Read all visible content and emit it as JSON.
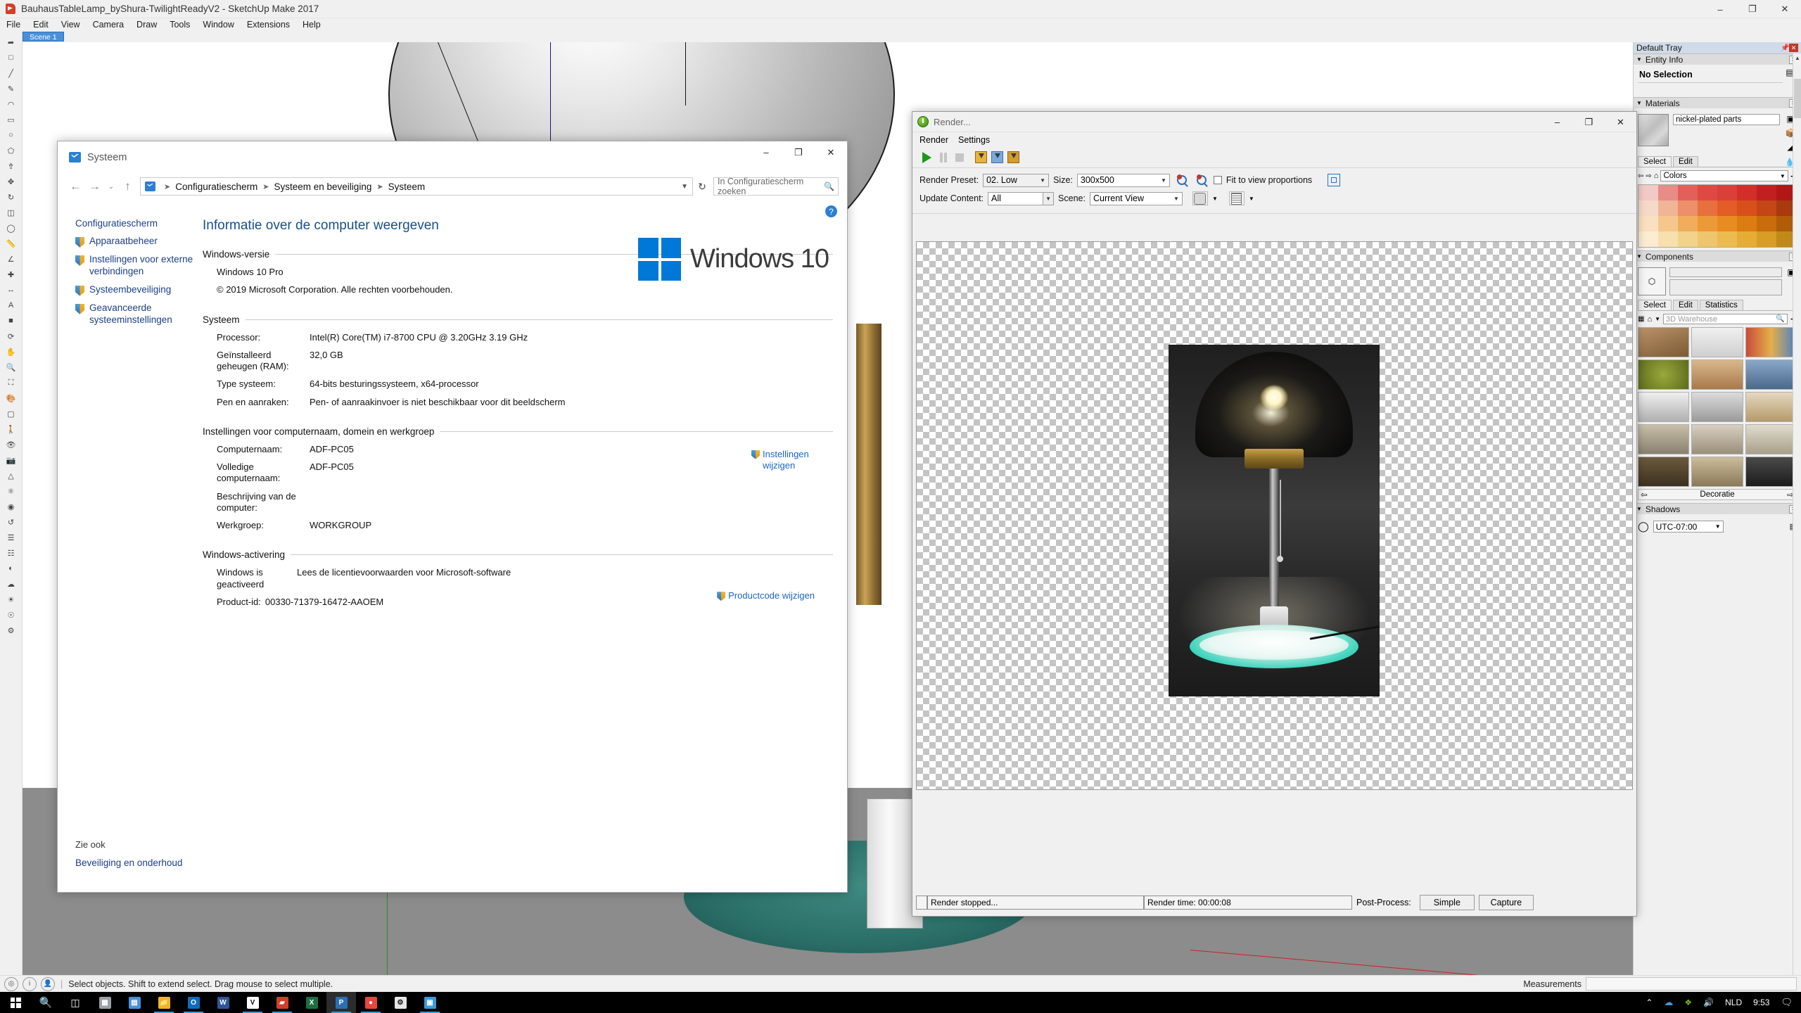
{
  "sketchup": {
    "title": "BauhausTableLamp_byShura-TwilightReadyV2 - SketchUp Make 2017",
    "menus": [
      "File",
      "Edit",
      "View",
      "Camera",
      "Draw",
      "Tools",
      "Window",
      "Extensions",
      "Help"
    ],
    "scene_tab": "Scene 1",
    "window_buttons": {
      "minimize": "–",
      "maximize": "❐",
      "close": "✕"
    },
    "status_text": "Select objects. Shift to extend select. Drag mouse to select multiple.",
    "measurements_label": "Measurements",
    "measurements_value": ""
  },
  "tray": {
    "title": "Default Tray",
    "pin": "📌",
    "close": "✕",
    "panels": {
      "entity_info": {
        "title": "Entity Info",
        "selection": "No Selection"
      },
      "materials": {
        "title": "Materials",
        "material_name": "nickel-plated parts",
        "tabs": [
          "Select",
          "Edit"
        ],
        "active_tab": "Select",
        "collection": "Colors",
        "swatches": [
          "#f2c9c6",
          "#e78c86",
          "#e3605a",
          "#de4a43",
          "#d94038",
          "#d12f28",
          "#c02020",
          "#b01818",
          "#f6d9c8",
          "#f0b497",
          "#ec8f6a",
          "#e8703f",
          "#e45c28",
          "#d94f1c",
          "#c44516",
          "#a83a12",
          "#fae0c0",
          "#f5c78d",
          "#f0ad5c",
          "#ec9a37",
          "#e88c22",
          "#dd7c12",
          "#c96c0c",
          "#b05c08",
          "#fbeccf",
          "#f7dfae",
          "#f3d28c",
          "#efc66c",
          "#ecbb4f",
          "#e6ad34",
          "#d79d24",
          "#c08a18"
        ]
      },
      "components": {
        "title": "Components",
        "name_field": "",
        "desc_field": "",
        "tabs": [
          "Select",
          "Edit",
          "Statistics"
        ],
        "active_tab": "Select",
        "warehouse_placeholder": "3D Warehouse",
        "pager_label": "Decoratie"
      },
      "shadows": {
        "title": "Shadows",
        "timezone": "UTC-07:00"
      }
    }
  },
  "systeem": {
    "window_title": "Systeem",
    "window_buttons": {
      "minimize": "–",
      "maximize": "❐",
      "close": "✕"
    },
    "nav": {
      "back": "←",
      "forward": "→",
      "history": "⌄",
      "up": "↑",
      "refresh": "↻"
    },
    "breadcrumbs": [
      "Configuratiescherm",
      "Systeem en beveiliging",
      "Systeem"
    ],
    "search_placeholder": "In Configuratiescherm zoeken",
    "sidebar": {
      "header": "Configuratiescherm",
      "items": [
        "Apparaatbeheer",
        "Instellingen voor externe verbindingen",
        "Systeembeveiliging",
        "Geavanceerde systeeminstellingen"
      ],
      "see_also_header": "Zie ook",
      "see_also_items": [
        "Beveiliging en onderhoud"
      ]
    },
    "page_title": "Informatie over de computer weergeven",
    "sections": {
      "windows_version": {
        "heading": "Windows-versie",
        "edition": "Windows 10 Pro",
        "copyright": "© 2019 Microsoft Corporation. Alle rechten voorbehouden.",
        "logo_text": "Windows 10"
      },
      "system": {
        "heading": "Systeem",
        "rows": [
          {
            "key": "Processor:",
            "value": "Intel(R) Core(TM) i7-8700 CPU @ 3.20GHz   3.19 GHz"
          },
          {
            "key": "Geïnstalleerd geheugen (RAM):",
            "value": "32,0 GB"
          },
          {
            "key": "Type systeem:",
            "value": "64-bits besturingssysteem, x64-processor"
          },
          {
            "key": "Pen en aanraken:",
            "value": "Pen- of aanraakinvoer is niet beschikbaar voor dit beeldscherm"
          }
        ]
      },
      "computer_name": {
        "heading": "Instellingen voor computernaam, domein en werkgroep",
        "rows": [
          {
            "key": "Computernaam:",
            "value": "ADF-PC05"
          },
          {
            "key": "Volledige computernaam:",
            "value": "ADF-PC05"
          },
          {
            "key": "Beschrijving van de computer:",
            "value": ""
          },
          {
            "key": "Werkgroep:",
            "value": "WORKGROUP"
          }
        ],
        "change_link": "Instellingen wijzigen"
      },
      "activation": {
        "heading": "Windows-activering",
        "status": "Windows is geactiveerd",
        "license_link": "Lees de licentievoorwaarden voor Microsoft-software",
        "product_id_label": "Product-id:",
        "product_id": "00330-71379-16472-AAOEM",
        "change_key_link": "Productcode wijzigen"
      }
    },
    "help_icon": "?"
  },
  "render": {
    "window_title": "Render...",
    "window_buttons": {
      "minimize": "–",
      "maximize": "❐",
      "close": "✕"
    },
    "menus": [
      "Render",
      "Settings"
    ],
    "toolbar_icons": [
      "play-icon",
      "pause-icon",
      "stop-icon",
      "save-image-icon",
      "save-channels-icon",
      "open-image-icon"
    ],
    "controls": {
      "render_preset_label": "Render Preset:",
      "render_preset_value": "02. Low",
      "size_label": "Size:",
      "size_value": "300x500",
      "fit_checkbox_label": "Fit to view proportions",
      "fit_checked": false,
      "update_content_label": "Update Content:",
      "update_content_value": "All",
      "scene_label": "Scene:",
      "scene_value": "Current View"
    },
    "status": {
      "render_state": "Render stopped...",
      "render_time": "Render time: 00:00:08",
      "post_process_label": "Post-Process:",
      "simple_button": "Simple",
      "capture_button": "Capture"
    }
  },
  "taskbar": {
    "start_icon": "windows-logo-icon",
    "search_icon": "search-icon",
    "taskview_icon": "task-view-icon",
    "apps": [
      {
        "name": "app-grid-icon",
        "label": "▦",
        "color": "#9aa0a6",
        "underline": false
      },
      {
        "name": "calculator-icon",
        "label": "▤",
        "color": "#4a90d9",
        "underline": false
      },
      {
        "name": "file-explorer-icon",
        "label": "📁",
        "color": "#f0b429",
        "underline": true
      },
      {
        "name": "outlook-icon",
        "label": "O",
        "color": "#0f6cbd",
        "underline": true
      },
      {
        "name": "word-icon",
        "label": "W",
        "color": "#2b579a",
        "underline": false
      },
      {
        "name": "vray-icon",
        "label": "V",
        "color": "#ffffff",
        "underline": true
      },
      {
        "name": "sketchup-icon",
        "label": "▰",
        "color": "#d23f28",
        "underline": true
      },
      {
        "name": "excel-icon",
        "label": "X",
        "color": "#1d6f42",
        "underline": false
      },
      {
        "name": "photoshop-icon",
        "label": "P",
        "color": "#2b6fb5",
        "underline": true
      },
      {
        "name": "chrome-icon",
        "label": "●",
        "color": "#e8453c",
        "underline": true
      },
      {
        "name": "settings-gear-icon",
        "label": "⚙",
        "color": "#e6e6e6",
        "underline": false
      },
      {
        "name": "contacts-icon",
        "label": "▣",
        "color": "#3a9bdc",
        "underline": true
      }
    ],
    "tray": {
      "chevron": "⌃",
      "onedrive_icon": "cloud-icon",
      "nvidia_icon": "nvidia-icon",
      "volume_icon": "🔊",
      "language": "NLD",
      "time": "9:53",
      "notification_icon": "notification-icon"
    }
  }
}
